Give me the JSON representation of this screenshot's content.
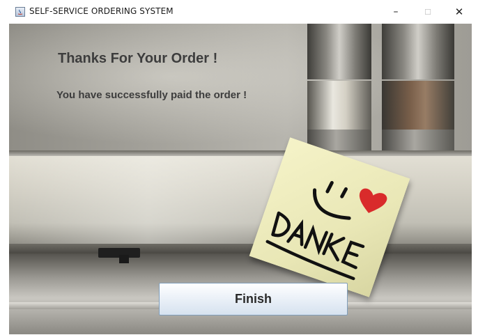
{
  "window": {
    "title": "SELF-SERVICE ORDERING SYSTEM",
    "controls": {
      "minimize": "–",
      "maximize": "☐",
      "close": "✕"
    }
  },
  "content": {
    "heading": "Thanks For Your Order !",
    "message": "You have successfully paid the order !",
    "finish_label": "Finish"
  },
  "icons": {
    "app": "java-app-icon",
    "note": "danke-sticky-note"
  },
  "colors": {
    "text": "#3d3d3d",
    "button_border": "#7f9db9",
    "heart": "#d92b2b"
  }
}
